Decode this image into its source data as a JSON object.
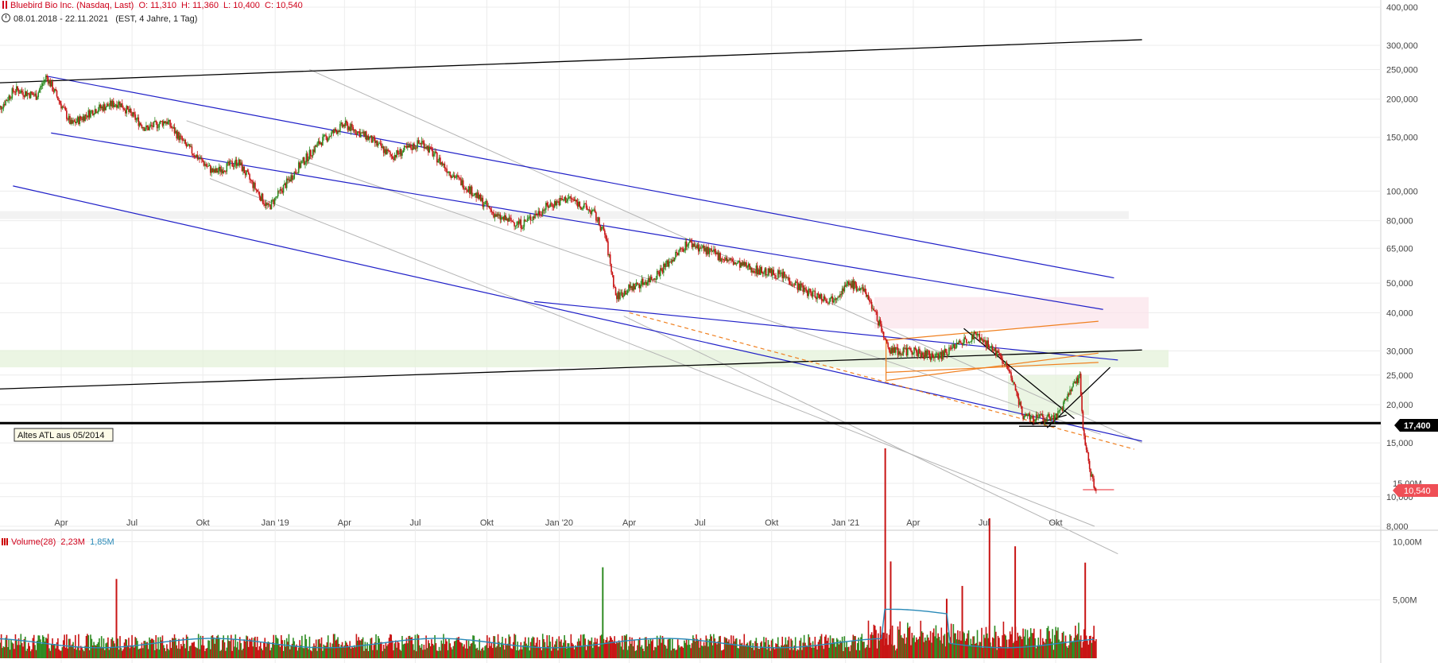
{
  "header": {
    "title": "Bluebird Bio Inc. (Nasdaq, Last)",
    "ohlc": "O: 11,310  H: 11,360  L: 10,400  C: 10,540",
    "range": "08.01.2018 - 22.11.2021",
    "interval": "(EST, 4 Jahre, 1 Tag)"
  },
  "volume_header": {
    "label": "Volume(28)",
    "value": "2,23M",
    "sma": "1,85M"
  },
  "annotations": {
    "old_atl_label": "Altes ATL aus 05/2014",
    "level_price": "17,400",
    "last_price": "10,540"
  },
  "colors": {
    "up": "#2e8b22",
    "down": "#c81414",
    "channel_blue": "#2020c8",
    "trend_black": "#000000",
    "orange": "#f08020",
    "grey_line": "#b4b4b4",
    "price_badge": "#ef4f56",
    "volume_sma": "#2a8ab8"
  },
  "chart_data": [
    {
      "type": "line",
      "title": "Bluebird Bio Inc. (Nasdaq, Last)",
      "y_scale": "log",
      "ylim": [
        7900,
        415000
      ],
      "xlim": [
        "2018-01-08",
        "2021-11-22"
      ],
      "y_ticks": [
        "400,000",
        "300,000",
        "250,000",
        "200,000",
        "150,000",
        "100,000",
        "80,000",
        "65,000",
        "50,000",
        "40,000",
        "30,000",
        "25,000",
        "20,000",
        "15,000",
        "10,000",
        "8,000"
      ],
      "y_tick_values": [
        400000,
        300000,
        250000,
        200000,
        150000,
        100000,
        80000,
        65000,
        50000,
        40000,
        30000,
        25000,
        20000,
        15000,
        10000,
        8000
      ],
      "x_ticks": [
        {
          "label": "Apr",
          "date": "2018-04-02"
        },
        {
          "label": "Jul",
          "date": "2018-07-02"
        },
        {
          "label": "Okt",
          "date": "2018-10-01"
        },
        {
          "label": "Jan '19",
          "date": "2019-01-02"
        },
        {
          "label": "Apr",
          "date": "2019-04-01"
        },
        {
          "label": "Jul",
          "date": "2019-07-01"
        },
        {
          "label": "Okt",
          "date": "2019-10-01"
        },
        {
          "label": "Jan '20",
          "date": "2020-01-02"
        },
        {
          "label": "Apr",
          "date": "2020-04-01"
        },
        {
          "label": "Jul",
          "date": "2020-07-01"
        },
        {
          "label": "Okt",
          "date": "2020-10-01"
        },
        {
          "label": "Jan '21",
          "date": "2021-01-04"
        },
        {
          "label": "Apr",
          "date": "2021-04-01"
        },
        {
          "label": "Jul",
          "date": "2021-07-01"
        },
        {
          "label": "Okt",
          "date": "2021-10-01"
        }
      ],
      "grid": true,
      "series": [
        {
          "name": "Bluebird Bio Inc. (Nasdaq, Last)",
          "x": [
            "2018-01-08",
            "2018-02-01",
            "2018-03-01",
            "2018-03-14",
            "2018-04-15",
            "2018-05-15",
            "2018-06-15",
            "2018-07-20",
            "2018-08-15",
            "2018-09-10",
            "2018-10-15",
            "2018-11-15",
            "2018-12-24",
            "2019-02-01",
            "2019-03-01",
            "2019-04-01",
            "2019-05-01",
            "2019-06-01",
            "2019-07-10",
            "2019-08-15",
            "2019-09-15",
            "2019-10-15",
            "2019-11-15",
            "2019-12-20",
            "2020-01-15",
            "2020-02-15",
            "2020-03-01",
            "2020-03-15",
            "2020-04-01",
            "2020-05-01",
            "2020-06-01",
            "2020-06-15",
            "2020-07-15",
            "2020-08-15",
            "2020-09-15",
            "2020-10-15",
            "2020-11-15",
            "2020-12-15",
            "2021-01-10",
            "2021-02-01",
            "2021-02-20",
            "2021-03-01",
            "2021-04-01",
            "2021-05-01",
            "2021-06-01",
            "2021-06-20",
            "2021-07-15",
            "2021-08-01",
            "2021-08-20",
            "2021-09-15",
            "2021-10-05",
            "2021-10-20",
            "2021-11-01",
            "2021-11-05",
            "2021-11-15",
            "2021-11-22"
          ],
          "y": [
            180000,
            215000,
            205000,
            238000,
            165000,
            185000,
            195000,
            160000,
            170000,
            140000,
            115000,
            125000,
            88000,
            120000,
            145000,
            165000,
            150000,
            130000,
            145000,
            115000,
            98000,
            82000,
            78000,
            90000,
            95000,
            85000,
            72000,
            45000,
            48000,
            52000,
            62000,
            68000,
            63000,
            58000,
            55000,
            53000,
            47000,
            44000,
            50000,
            46000,
            35000,
            30000,
            30000,
            28500,
            32000,
            34000,
            30000,
            26000,
            18500,
            18000,
            18600,
            22000,
            25000,
            16800,
            11800,
            10540
          ]
        }
      ],
      "horizontal_lines": [
        17400
      ],
      "annotation_text": [
        "Altes ATL aus 05/2014"
      ]
    },
    {
      "type": "bar",
      "title": "Volume(28)",
      "y_ticks": [
        "15,00M",
        "10,00M",
        "5,00M"
      ],
      "y_tick_values": [
        15000000,
        10000000,
        5000000
      ],
      "ylim": [
        0,
        19000000
      ],
      "spikes": [
        {
          "date": "2018-06-12",
          "value": 6800000,
          "dir": "down"
        },
        {
          "date": "2020-02-27",
          "value": 7800000,
          "dir": "up"
        },
        {
          "date": "2021-02-24",
          "value": 18000000,
          "dir": "down"
        },
        {
          "date": "2021-03-03",
          "value": 8300000,
          "dir": "down"
        },
        {
          "date": "2021-05-14",
          "value": 5100000,
          "dir": "down"
        },
        {
          "date": "2021-06-03",
          "value": 6200000,
          "dir": "down"
        },
        {
          "date": "2021-07-08",
          "value": 12000000,
          "dir": "down"
        },
        {
          "date": "2021-08-10",
          "value": 9600000,
          "dir": "down"
        },
        {
          "date": "2021-11-08",
          "value": 8200000,
          "dir": "down"
        }
      ],
      "sma_value": "1,85M"
    }
  ]
}
